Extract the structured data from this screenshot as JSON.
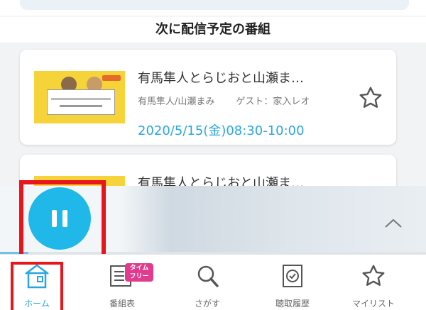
{
  "section": {
    "title": "次に配信予定の番組"
  },
  "programs": [
    {
      "title": "有馬隼人とらじおと山瀬ま…",
      "hosts": "有馬隼人/山瀬まみ",
      "guest": "ゲスト：家入レオ",
      "datetime": "2020/5/15(金)08:30-10:00",
      "favorite": false
    },
    {
      "title": "有馬隼人とらじおと山瀬ま…"
    }
  ],
  "player": {
    "state": "playing",
    "pause_icon": "pause-icon",
    "expand_icon": "chevron-up-icon"
  },
  "tabs": [
    {
      "label": "ホーム",
      "icon": "home-icon",
      "active": true
    },
    {
      "label": "番組表",
      "icon": "schedule-icon",
      "badge": "タイム\nフリー",
      "active": false
    },
    {
      "label": "さがす",
      "icon": "search-icon",
      "active": false
    },
    {
      "label": "聴取履歴",
      "icon": "history-icon",
      "active": false
    },
    {
      "label": "マイリスト",
      "icon": "star-icon",
      "active": false
    }
  ],
  "colors": {
    "accent": "#29a6e0",
    "play_button": "#1fb8e8",
    "highlight": "#e8151b",
    "badge": "#e23a8e"
  }
}
